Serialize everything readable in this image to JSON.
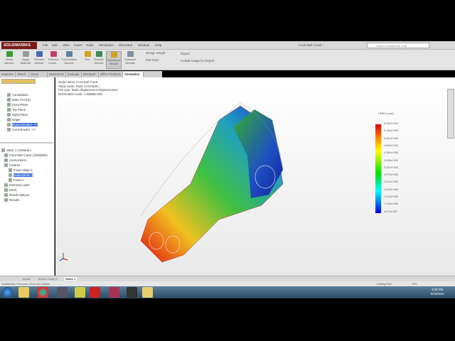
{
  "app": {
    "logo": "SOLIDWORKS",
    "doc_title": "Front Bell Crank *",
    "search_placeholder": "Search SolidWorks Help"
  },
  "menu": [
    "File",
    "Edit",
    "View",
    "Insert",
    "Tools",
    "Simulation",
    "3Dcontrol",
    "Window",
    "Help"
  ],
  "ribbon": [
    {
      "label": "Study Advisor",
      "color": "#3a9a3a"
    },
    {
      "label": "Apply Material",
      "color": "#999999"
    },
    {
      "label": "Fixtures Advisor",
      "color": "#4a6ab0"
    },
    {
      "label": "External Loads...",
      "color": "#c04070"
    },
    {
      "label": "Connections Advisor",
      "color": "#6080a0"
    },
    {
      "label": "Run",
      "color": "#d0a020"
    },
    {
      "label": "Results Advisor",
      "color": "#3a8a4a"
    },
    {
      "label": "Deformed Result",
      "color": "#d0a020"
    },
    {
      "label": "Compare Results",
      "color": "#8090a0"
    }
  ],
  "ribbon_small": [
    "Design Insight",
    "Plot Tools",
    "Report",
    "Include Image for Report"
  ],
  "tabs": [
    "Features",
    "Sketch",
    "Sheet Metal",
    "Weldments",
    "Evaluate",
    "DimXpert",
    "Office Products",
    "Simulation"
  ],
  "feature_tree": [
    "Annotations",
    "6061-T6 (SS)",
    "Front Plane",
    "Top Plane",
    "Right Plane",
    "Origin",
    "Boss-Extrude1 ->?",
    "Cut-Extrude1 ->?"
  ],
  "sim_tree": [
    "Static 1 (-Default-)",
    "Front Bell Crank (-[SW]6061-",
    "Connections",
    "Fixtures",
    "Fixed Hinge-1",
    "Roller/Slider-1",
    "Fixed-1",
    "External Loads",
    "Mesh",
    "Result Options",
    "Results"
  ],
  "plot_info": [
    "Model name: Front Bell Crank",
    "Study name: Static 1(-Default-)",
    "Plot type: Static displacement Displacement1",
    "Deformation scale: 1.93689e-000"
  ],
  "legend": {
    "title": "URES (mm)",
    "values": [
      "6.250e+000",
      "5.789e+000",
      "5.321e+000",
      "4.853e+000",
      "4.384e+000",
      "3.916e+000",
      "3.447e+000",
      "2.979e+000",
      "2.511e+000",
      "2.042e+000",
      "1.574e+000",
      "1.105e+000",
      "6.373e-001"
    ]
  },
  "bottom_tabs": [
    "Model",
    "Motion Study 1",
    "Static 1"
  ],
  "status": {
    "edition": "SolidWorks Premium 2014 x64 Edition",
    "mode": "Editing Part",
    "units": "IPS"
  },
  "clock": {
    "time": "6:38 PM",
    "date": "9/16/2014"
  }
}
